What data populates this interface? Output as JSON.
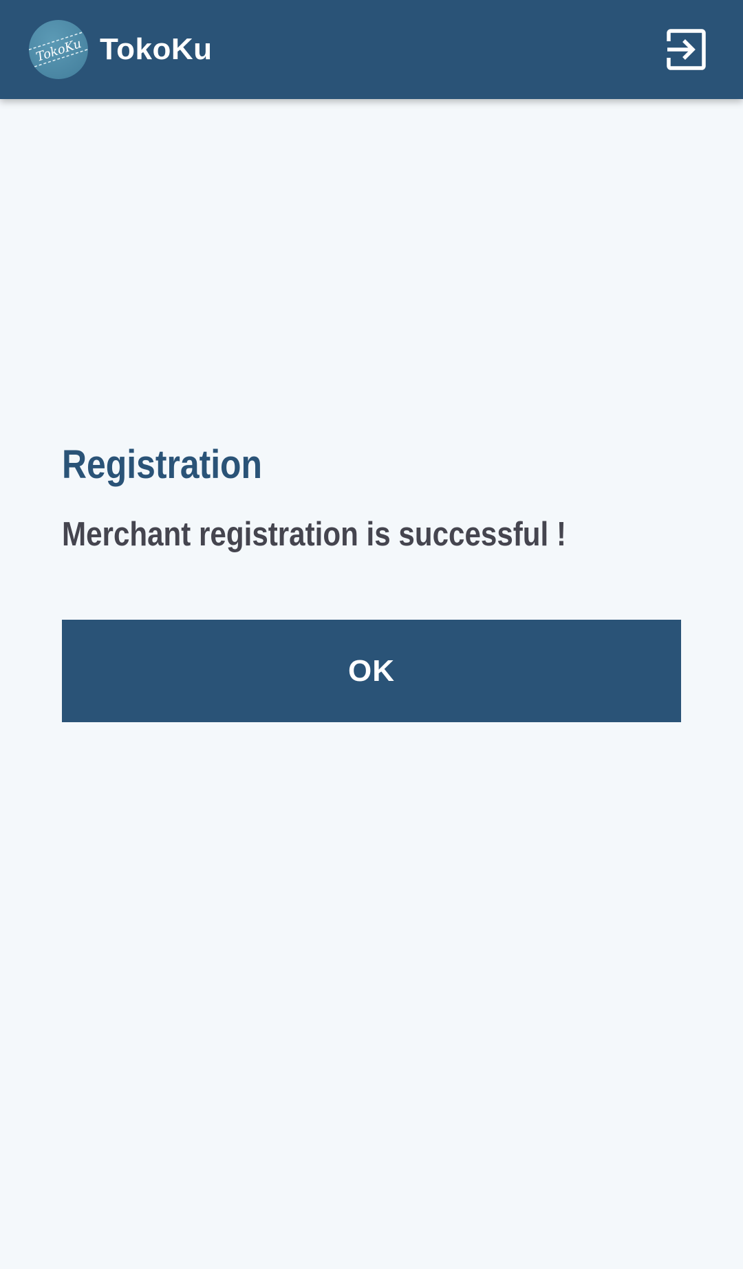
{
  "app_bar": {
    "title": "TokoKu",
    "logo_text": "TokoKu",
    "logo_icon": "tokoku-logo",
    "action_icon": "logout-icon"
  },
  "dialog": {
    "heading": "Registration",
    "message": "Merchant registration is successful !",
    "ok_label": "OK"
  },
  "colors": {
    "primary": "#2a5377",
    "background": "#f4f8fb",
    "text": "#45454f",
    "on_primary": "#ffffff"
  }
}
